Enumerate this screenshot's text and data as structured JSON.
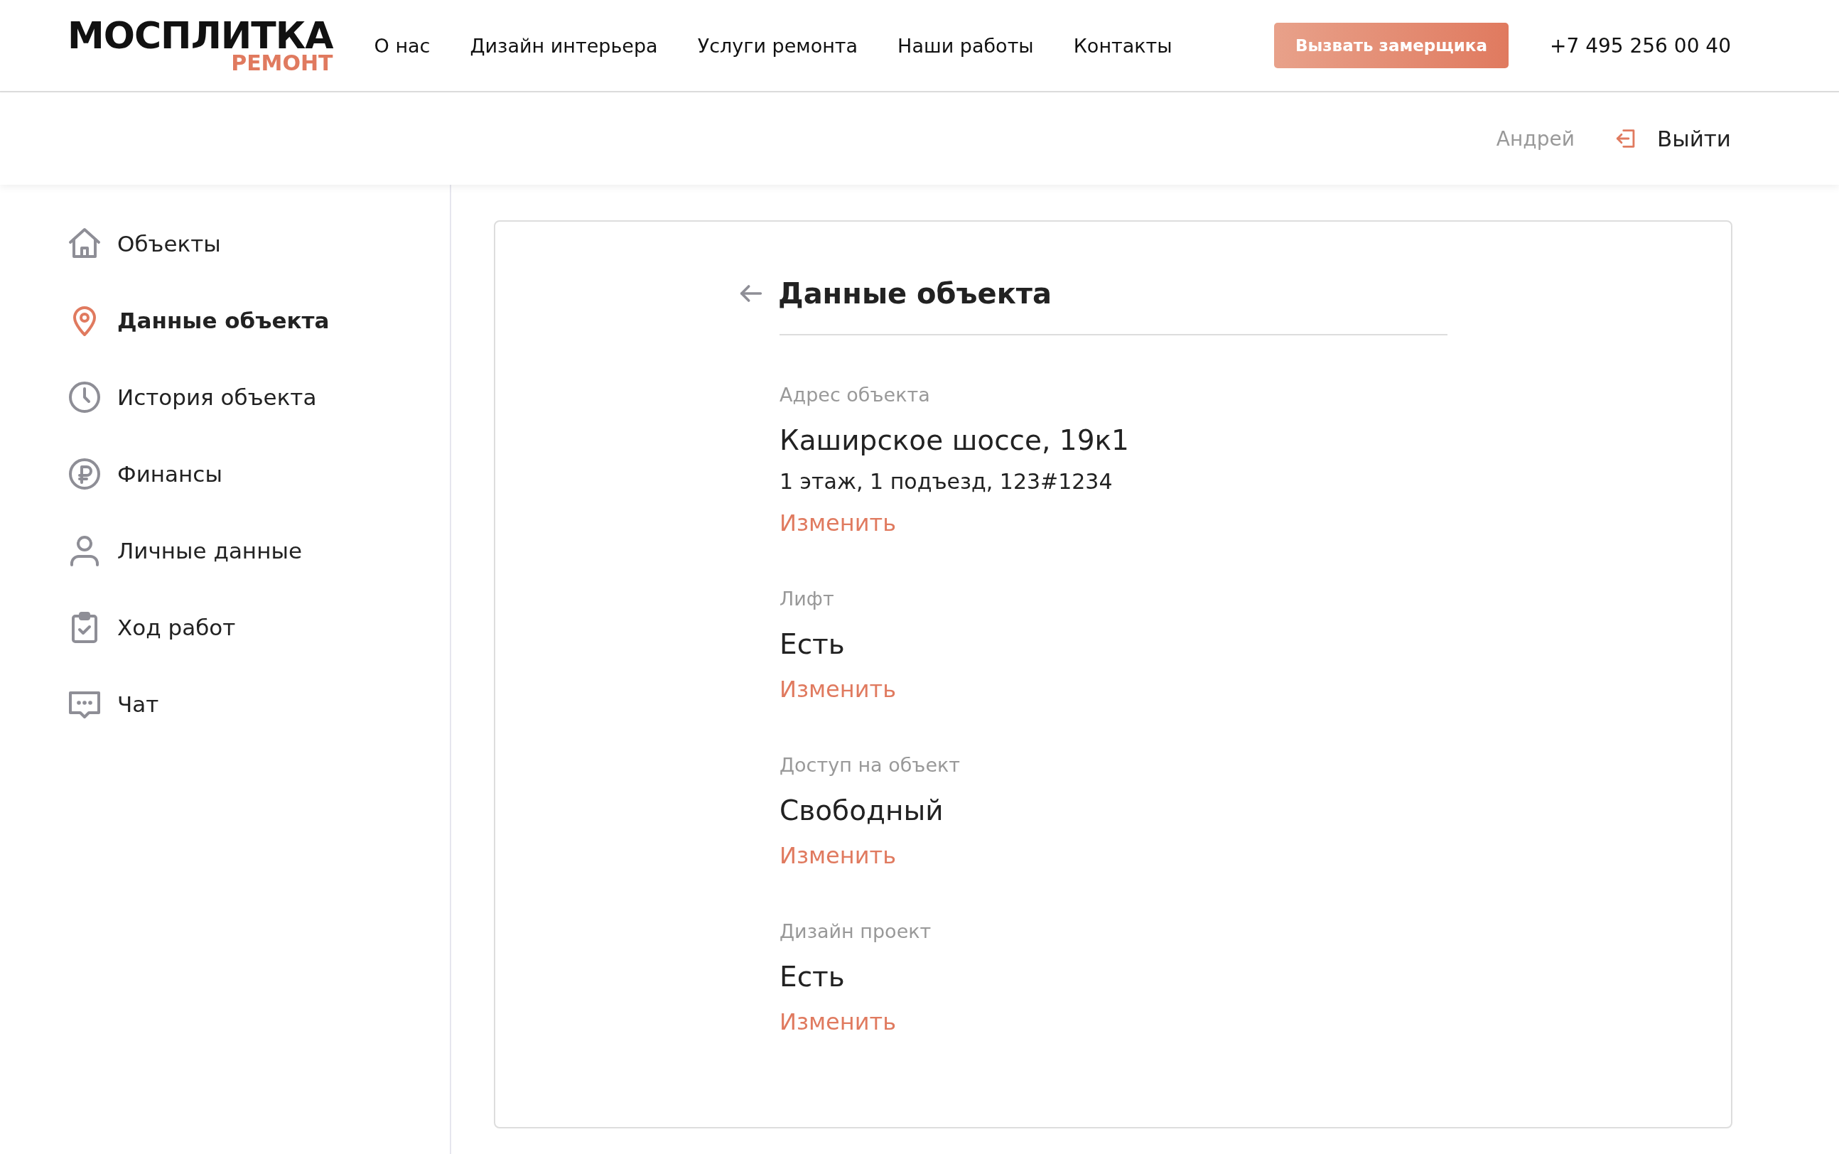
{
  "header": {
    "logo": {
      "title": "МОСПЛИТКА",
      "subtitle": "РЕМОНТ"
    },
    "nav": [
      "О нас",
      "Дизайн интерьера",
      "Услуги ремонта",
      "Наши работы",
      "Контакты"
    ],
    "cta_button": "Вызвать замерщика",
    "phone": "+7 495 256 00 40"
  },
  "user_bar": {
    "user_name": "Андрей",
    "logout": "Выйти"
  },
  "sidebar": {
    "items": [
      {
        "label": "Объекты",
        "selected": false
      },
      {
        "label": "Данные объекта",
        "selected": true
      },
      {
        "label": "История объекта",
        "selected": false
      },
      {
        "label": "Финансы",
        "selected": false
      },
      {
        "label": "Личные данные",
        "selected": false
      },
      {
        "label": "Ход работ",
        "selected": false
      },
      {
        "label": "Чат",
        "selected": false
      }
    ]
  },
  "content": {
    "title": "Данные объекта",
    "fields": [
      {
        "label": "Адрес объекта",
        "value": "Каширское шоссе, 19к1",
        "detail": "1 этаж, 1 подъезд, 123#1234",
        "link": "Изменить"
      },
      {
        "label": "Лифт",
        "value": "Есть",
        "link": "Изменить"
      },
      {
        "label": "Доступ на объект",
        "value": "Свободный",
        "link": "Изменить"
      },
      {
        "label": "Дизайн проект",
        "value": "Есть",
        "link": "Изменить"
      }
    ]
  }
}
